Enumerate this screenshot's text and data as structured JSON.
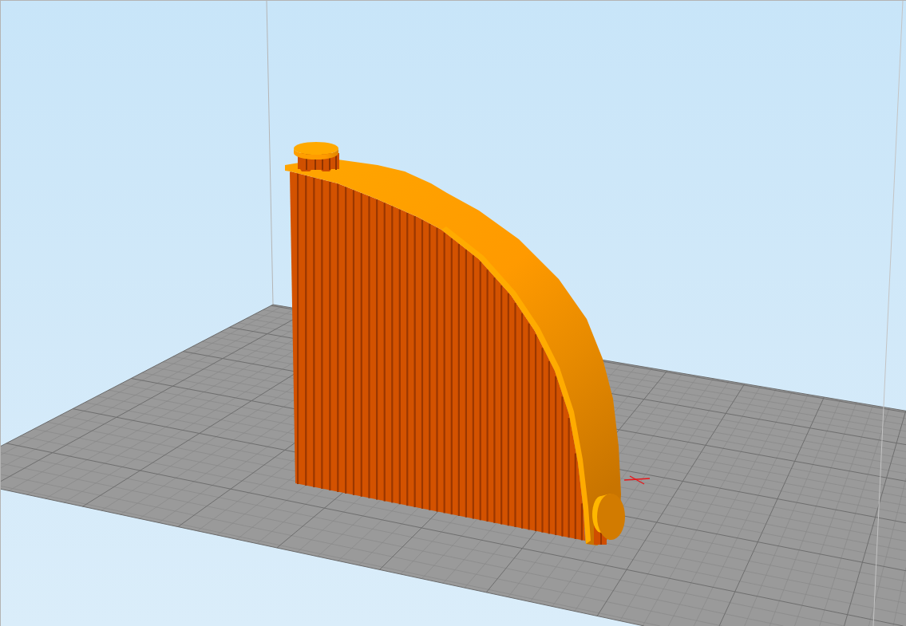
{
  "viewport": {
    "build_plate": {
      "grid": true
    },
    "model": {
      "supports": true
    }
  }
}
